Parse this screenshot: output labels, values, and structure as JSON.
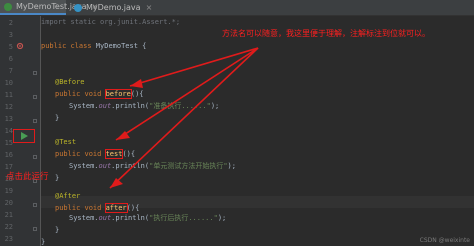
{
  "tabs": [
    {
      "label": "MyDemoTest.java",
      "icon": "java-test-class-icon",
      "active": true
    },
    {
      "label": "MyDemo.java",
      "icon": "java-class-icon",
      "active": false
    }
  ],
  "code_lines": [
    {
      "num": "2",
      "text": "import static org.junit.Assert.*;"
    },
    {
      "num": "3",
      "text": ""
    },
    {
      "num": "5",
      "text": "public class MyDemoTest {"
    },
    {
      "num": "6",
      "text": ""
    },
    {
      "num": "7",
      "text": ""
    },
    {
      "num": "10",
      "text": "@Before"
    },
    {
      "num": "11",
      "text": "public void before(){"
    },
    {
      "num": "12",
      "text": "System.out.println(\"准备执行......\");"
    },
    {
      "num": "13",
      "text": "}"
    },
    {
      "num": "14",
      "text": ""
    },
    {
      "num": "15",
      "text": "@Test"
    },
    {
      "num": "16",
      "text": "public void test(){"
    },
    {
      "num": "17",
      "text": "System.out.println(\"单元测试方法开始执行\");"
    },
    {
      "num": "18",
      "text": "}"
    },
    {
      "num": "19",
      "text": ""
    },
    {
      "num": "20",
      "text": "@After"
    },
    {
      "num": "21",
      "text": "public void after(){"
    },
    {
      "num": "22",
      "text": "System.out.println(\"执行后执行......\");"
    },
    {
      "num": "23",
      "text": "}"
    },
    {
      "num": "24",
      "text": ""
    },
    {
      "num": "25",
      "text": "}"
    }
  ],
  "annotations": {
    "top_note": "方法名可以随意，我这里便于理解，注解标注到位就可以。",
    "run_note": "点击此运行"
  },
  "watermark": "CSDN @weixinte",
  "colors": {
    "background": "#2b2b2b",
    "annotation": "#e01b1b",
    "keyword": "#cc7832",
    "annotation_code": "#bbb529",
    "string": "#6a8759",
    "run_arrow": "#499c54"
  }
}
